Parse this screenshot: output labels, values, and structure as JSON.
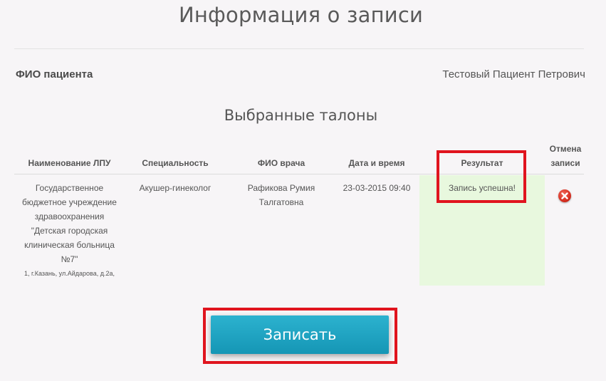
{
  "page": {
    "title": "Информация о записи"
  },
  "patient": {
    "label": "ФИО пациента",
    "value": "Тестовый Пациент Петрович"
  },
  "tickets": {
    "title": "Выбранные талоны",
    "columns": {
      "name": "Наименование ЛПУ",
      "specialty": "Специальность",
      "doctor": "ФИО врача",
      "datetime": "Дата и время",
      "result": "Результат",
      "cancel_line1": "Отмена",
      "cancel_line2": "записи"
    },
    "rows": [
      {
        "name_lines": [
          "Государственное",
          "бюджетное учреждение",
          "здравоохранения",
          "\"Детская городская",
          "клиническая больница",
          "№7\""
        ],
        "address": "1, г.Казань, ул.Айдарова, д.2а,",
        "specialty": "Акушер-гинеколог",
        "doctor_lines": [
          "Рафикова Румия",
          "Талгатовна"
        ],
        "datetime": "23-03-2015 09:40",
        "result": "Запись успешна!",
        "cancel_icon": "cancel-icon",
        "result_bg": "#e8f8de"
      }
    ]
  },
  "actions": {
    "submit_label": "Записать"
  },
  "colors": {
    "accent": "#1ea4c3",
    "highlight": "#e0141e",
    "cancel": "#d72f21"
  }
}
